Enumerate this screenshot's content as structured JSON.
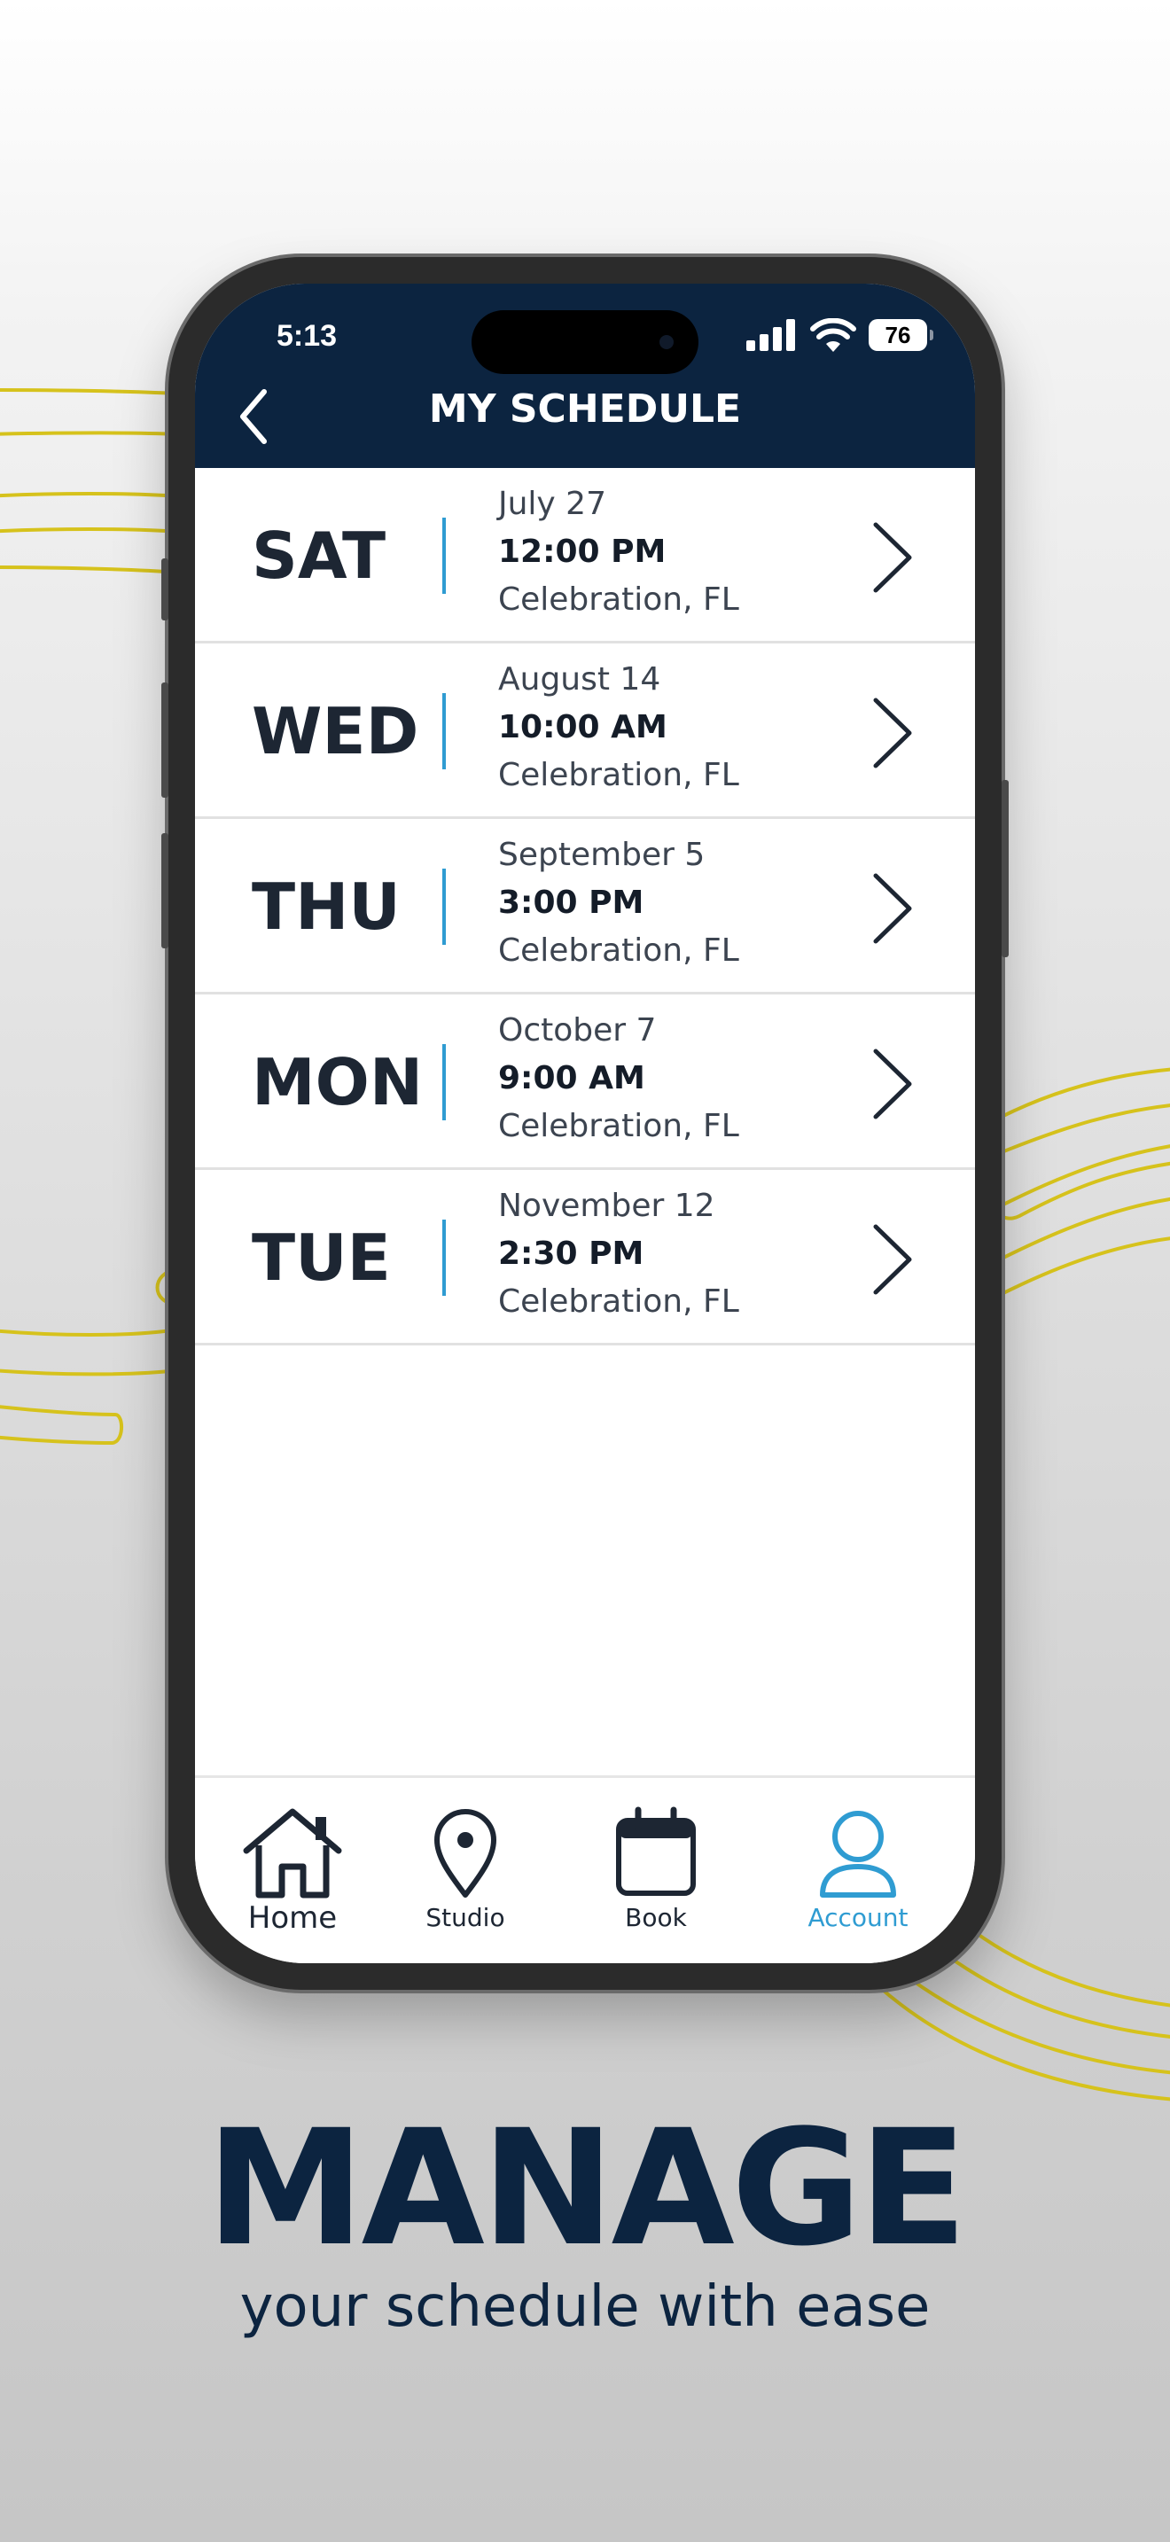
{
  "colors": {
    "navy": "#0c2440",
    "accent_blue": "#2f9cd2",
    "decor_yellow": "#d6c21c"
  },
  "status_bar": {
    "time": "5:13",
    "battery": "76",
    "icons": [
      "cellular-signal-icon",
      "wifi-icon",
      "battery-icon"
    ]
  },
  "nav": {
    "title": "MY SCHEDULE",
    "back_icon": "chevron-left-icon"
  },
  "schedule": [
    {
      "day": "SAT",
      "date": "July 27",
      "time": "12:00 PM",
      "location": "Celebration, FL"
    },
    {
      "day": "WED",
      "date": "August 14",
      "time": "10:00 AM",
      "location": "Celebration, FL"
    },
    {
      "day": "THU",
      "date": "September 5",
      "time": "3:00 PM",
      "location": "Celebration, FL"
    },
    {
      "day": "MON",
      "date": "October 7",
      "time": "9:00 AM",
      "location": "Celebration, FL"
    },
    {
      "day": "TUE",
      "date": "November 12",
      "time": "2:30 PM",
      "location": "Celebration, FL"
    }
  ],
  "tabs": [
    {
      "label": "Home",
      "icon": "home-icon",
      "active": false
    },
    {
      "label": "Studio",
      "icon": "map-pin-icon",
      "active": false
    },
    {
      "label": "Book",
      "icon": "calendar-icon",
      "active": false
    },
    {
      "label": "Account",
      "icon": "user-icon",
      "active": true
    }
  ],
  "promo": {
    "headline": "MANAGE",
    "subline": "your schedule with ease"
  }
}
